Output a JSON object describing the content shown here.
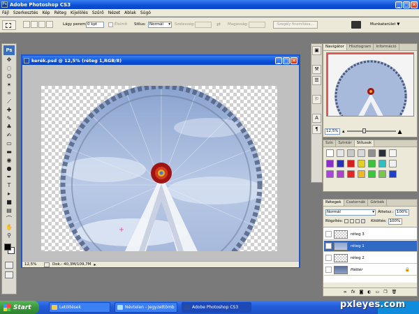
{
  "app": {
    "title": "Adobe Photoshop CS3",
    "icon": "ps-icon",
    "controls": [
      "_",
      "□",
      "✕"
    ]
  },
  "menu": [
    "Fájl",
    "Szerkesztés",
    "Kép",
    "Réteg",
    "Kijelölés",
    "Szűrő",
    "Nézet",
    "Ablak",
    "Súgó"
  ],
  "options": {
    "feather_label": "Lágy perem:",
    "feather_value": "0 kpt",
    "antialias_label": "Élsimít",
    "style_label": "Stílus:",
    "style_value": "Normál",
    "width_label": "Szélesség:",
    "height_label": "Magasság:",
    "refine_label": "Szegély finomítása...",
    "workspace_label": "Munkaterület ▼"
  },
  "toolbox": {
    "logo": "Ps",
    "tools": [
      "move-icon",
      "marquee-icon",
      "lasso-icon",
      "magic-wand-icon",
      "crop-icon",
      "slice-icon",
      "healing-icon",
      "brush-icon",
      "stamp-icon",
      "history-brush-icon",
      "eraser-icon",
      "gradient-icon",
      "blur-icon",
      "dodge-icon",
      "pen-icon",
      "type-icon",
      "path-select-icon",
      "shape-icon",
      "notes-icon",
      "eyedropper-icon",
      "hand-icon",
      "zoom-icon"
    ],
    "tool_glyphs": [
      "✥",
      "◌",
      "ʘ",
      "✶",
      "⌗",
      "⟋",
      "✚",
      "✎",
      "♣",
      "✍",
      "▭",
      "▬",
      "◉",
      "●",
      "✒",
      "T",
      "▸",
      "■",
      "▤",
      "⌒",
      "✋",
      "⚲"
    ]
  },
  "document": {
    "title": "kerék.psd @ 12,5% (réteg 1,RGB/8)",
    "zoom": "12,5%",
    "doc_info": "Dok.: 40,3M/109,7M"
  },
  "panel_strip": [
    "▣",
    "⚒",
    "☰",
    "⚐",
    "A",
    "¶"
  ],
  "navigator": {
    "tabs": [
      "Navigátor",
      "Hisztogram",
      "Információ"
    ],
    "zoom": "12,5%"
  },
  "swatches": {
    "tabs": [
      "Szín",
      "Színtár",
      "Stílusok"
    ],
    "colors": [
      "#ffffff",
      "#e6e6e6",
      "#c8c8c8",
      "#d8d8d8",
      "#909090",
      "#2a3038",
      "#f4f4f4",
      "#8a2fc8",
      "#2830b8",
      "#d02020",
      "#e0d020",
      "#40c040",
      "#2cc0c0",
      "#f0f0f0",
      "#a848d8",
      "#b040d0",
      "#e02828",
      "#f0b820",
      "#38c838",
      "#78c848",
      "#2040c8"
    ]
  },
  "layers": {
    "tabs": [
      "Rétegek",
      "Csatornák",
      "Görbék"
    ],
    "blend_mode": "Normál",
    "opacity_label": "Áttetsz.:",
    "opacity_value": "100%",
    "lock_label": "Rögzítés:",
    "fill_label": "Kitöltés:",
    "fill_value": "100%",
    "items": [
      {
        "name": "réteg 3",
        "visible": false,
        "selected": false,
        "thumb": "transparent"
      },
      {
        "name": "réteg 1",
        "visible": true,
        "selected": true,
        "thumb": "wheel"
      },
      {
        "name": "réteg 2",
        "visible": false,
        "selected": false,
        "thumb": "transparent"
      },
      {
        "name": "Háttér",
        "visible": false,
        "selected": false,
        "thumb": "bg"
      }
    ],
    "footer_icons": [
      "link-icon",
      "fx-icon",
      "mask-icon",
      "adjustment-icon",
      "folder-icon",
      "new-layer-icon",
      "trash-icon"
    ],
    "footer_glyphs": [
      "∞",
      "fx",
      "◙",
      "◐",
      "▭",
      "❐",
      "🗑"
    ]
  },
  "taskbar": {
    "start": "Start",
    "items": [
      "Letöltések",
      "Névtelen - Jegyzettömb",
      "Adobe Photoshop CS3"
    ]
  },
  "watermark": "pxleyes.com"
}
